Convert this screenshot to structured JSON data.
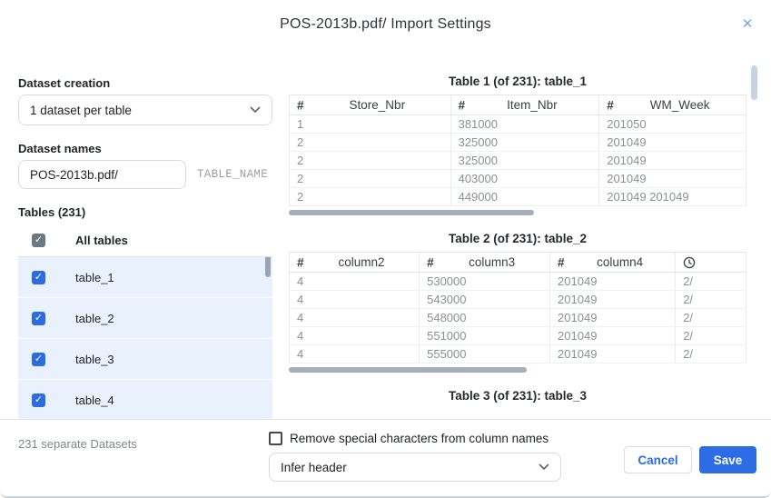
{
  "dialog": {
    "title": "POS-2013b.pdf/ Import Settings"
  },
  "icons": {
    "close-icon": "✕",
    "checkmark-icon": "✓",
    "number-type-icon": "#"
  },
  "left": {
    "dataset_creation_label": "Dataset creation",
    "dataset_creation_value": "1 dataset per table",
    "dataset_names_label": "Dataset names",
    "dataset_name_value": "POS-2013b.pdf/",
    "dataset_name_suffix": "TABLE_NAME",
    "tables_label": "Tables (231)",
    "all_tables_label": "All tables",
    "all_tables_checked": true,
    "tables": [
      {
        "label": "table_1",
        "checked": true
      },
      {
        "label": "table_2",
        "checked": true
      },
      {
        "label": "table_3",
        "checked": true
      },
      {
        "label": "table_4",
        "checked": true
      }
    ]
  },
  "preview": {
    "tables": [
      {
        "title": "Table 1 (of 231): table_1",
        "columns": [
          {
            "type": "number",
            "label": "Store_Nbr"
          },
          {
            "type": "number",
            "label": "Item_Nbr"
          },
          {
            "type": "number",
            "label": "WM_Week"
          }
        ],
        "rows": [
          [
            "1",
            "381000",
            "201050"
          ],
          [
            "2",
            "325000",
            "201049"
          ],
          [
            "2",
            "325000",
            "201049"
          ],
          [
            "2",
            "403000",
            "201049"
          ],
          [
            "2",
            "449000",
            "201049 201049"
          ]
        ]
      },
      {
        "title": "Table 2 (of 231): table_2",
        "columns": [
          {
            "type": "number",
            "label": "column2"
          },
          {
            "type": "number",
            "label": "column3"
          },
          {
            "type": "number",
            "label": "column4"
          },
          {
            "type": "time",
            "label": ""
          }
        ],
        "rows": [
          [
            "4",
            "530000",
            "201049",
            "2/"
          ],
          [
            "4",
            "543000",
            "201049",
            "2/"
          ],
          [
            "4",
            "548000",
            "201049",
            "2/"
          ],
          [
            "4",
            "551000",
            "201049",
            "2/"
          ],
          [
            "4",
            "555000",
            "201049",
            "2/"
          ]
        ]
      },
      {
        "title": "Table 3 (of 231): table_3",
        "columns": [],
        "rows": []
      }
    ]
  },
  "footer": {
    "datasets_summary": "231 separate Datasets",
    "remove_special_label": "Remove special characters from column names",
    "remove_special_checked": false,
    "header_mode_value": "Infer header",
    "cancel_label": "Cancel",
    "save_label": "Save"
  },
  "colors": {
    "accent_blue": "#2c6ce4",
    "checkbox_blue": "#2e6be0",
    "checkbox_gray": "#6e7881",
    "row_highlight": "#e9f2fc",
    "close_blue": "#7ba3f2"
  }
}
